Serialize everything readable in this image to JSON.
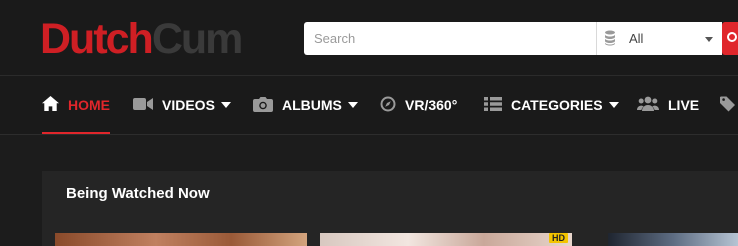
{
  "logo": {
    "part1": "Dutch",
    "part2": "Cum"
  },
  "search": {
    "placeholder": "Search",
    "value": ""
  },
  "filter": {
    "selected": "All"
  },
  "nav": {
    "items": [
      {
        "label": "HOME",
        "icon": "home-icon",
        "active": true
      },
      {
        "label": "VIDEOS",
        "icon": "video-camera-icon",
        "dropdown": true
      },
      {
        "label": "ALBUMS",
        "icon": "camera-icon",
        "dropdown": true
      },
      {
        "label": "VR/360°",
        "icon": "compass-icon"
      },
      {
        "label": "CATEGORIES",
        "icon": "list-icon",
        "dropdown": true
      },
      {
        "label": "LIVE",
        "icon": "users-icon"
      }
    ]
  },
  "section": {
    "title": "Being Watched Now"
  },
  "thumbnails": [
    {
      "badge": ""
    },
    {
      "badge": "HD"
    },
    {
      "badge": ""
    }
  ],
  "colors": {
    "accent": "#e0262b",
    "background": "#1c1c1c",
    "panel": "#252525"
  }
}
